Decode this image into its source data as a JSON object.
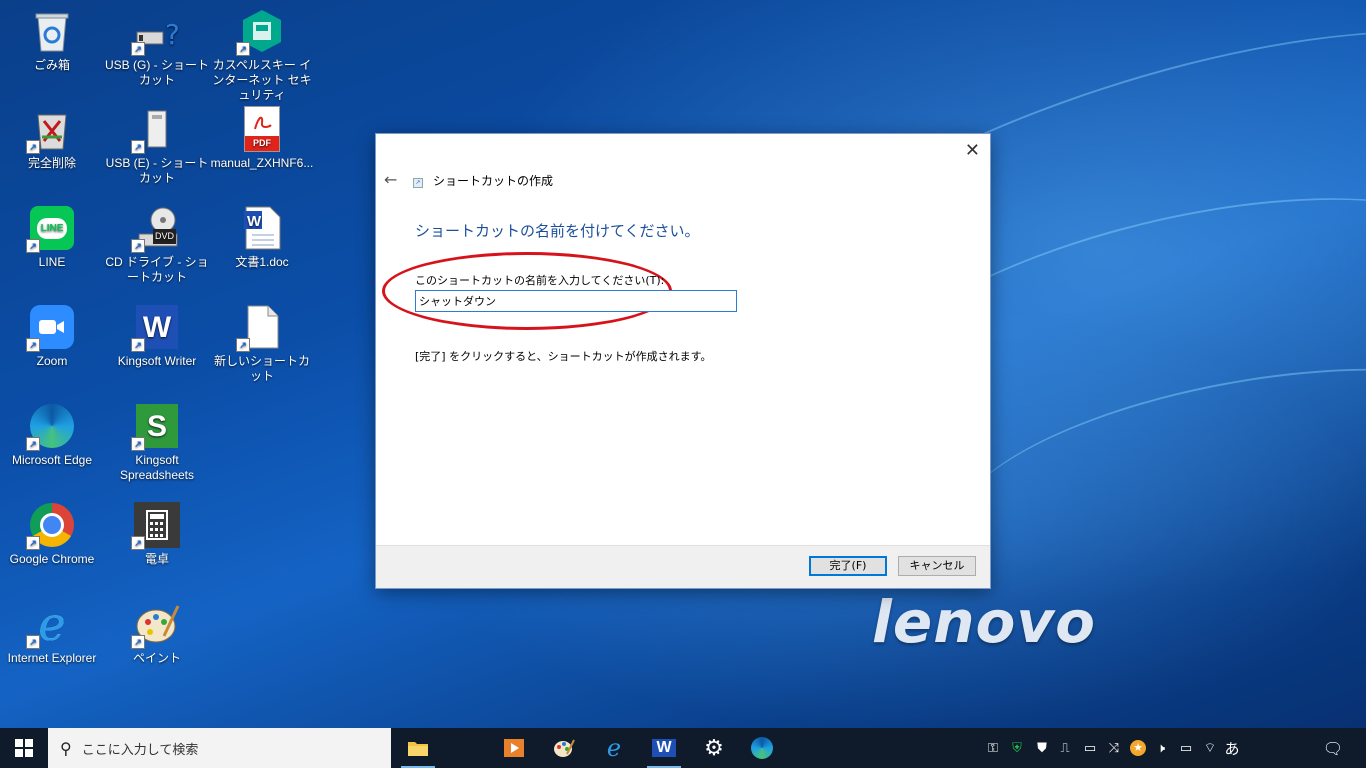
{
  "desktop_icons": [
    {
      "label": "ごみ箱"
    },
    {
      "label": "USB (G) - ショートカット"
    },
    {
      "label": "カスペルスキー インターネット セキュリティ"
    },
    {
      "label": "完全削除"
    },
    {
      "label": "USB (E) - ショートカット"
    },
    {
      "label": "manual_ZXHNF6..."
    },
    {
      "label": "LINE"
    },
    {
      "label": "CD ドライブ - ショートカット"
    },
    {
      "label": "文書1.doc"
    },
    {
      "label": "Zoom"
    },
    {
      "label": "Kingsoft Writer"
    },
    {
      "label": "新しいショートカット"
    },
    {
      "label": "Microsoft Edge"
    },
    {
      "label": "Kingsoft Spreadsheets"
    },
    {
      "label": "Google Chrome"
    },
    {
      "label": "電卓"
    },
    {
      "label": "Internet Explorer"
    },
    {
      "label": "ペイント"
    }
  ],
  "icon_text": {
    "line": "LINE",
    "pdf": "PDF",
    "dvd": "DVD",
    "writer": "W",
    "sheets": "S",
    "ie": "e"
  },
  "dialog": {
    "window_title": "ショートカットの作成",
    "close_glyph": "✕",
    "back_glyph": "←",
    "heading": "ショートカットの名前を付けてください。",
    "input_label": "このショートカットの名前を入力してください(T):",
    "input_value": "シャットダウン",
    "note": "[完了] をクリックすると、ショートカットが作成されます。",
    "finish_button": "完了(F)",
    "cancel_button": "キャンセル",
    "highlight_color": "#d6131b"
  },
  "brand": {
    "logo_text": "lenovo"
  },
  "taskbar": {
    "search_placeholder": "ここに入力して検索",
    "search_glyph": "⚲",
    "ime_indicator": "あ",
    "accent_color": "#76b9ed"
  }
}
